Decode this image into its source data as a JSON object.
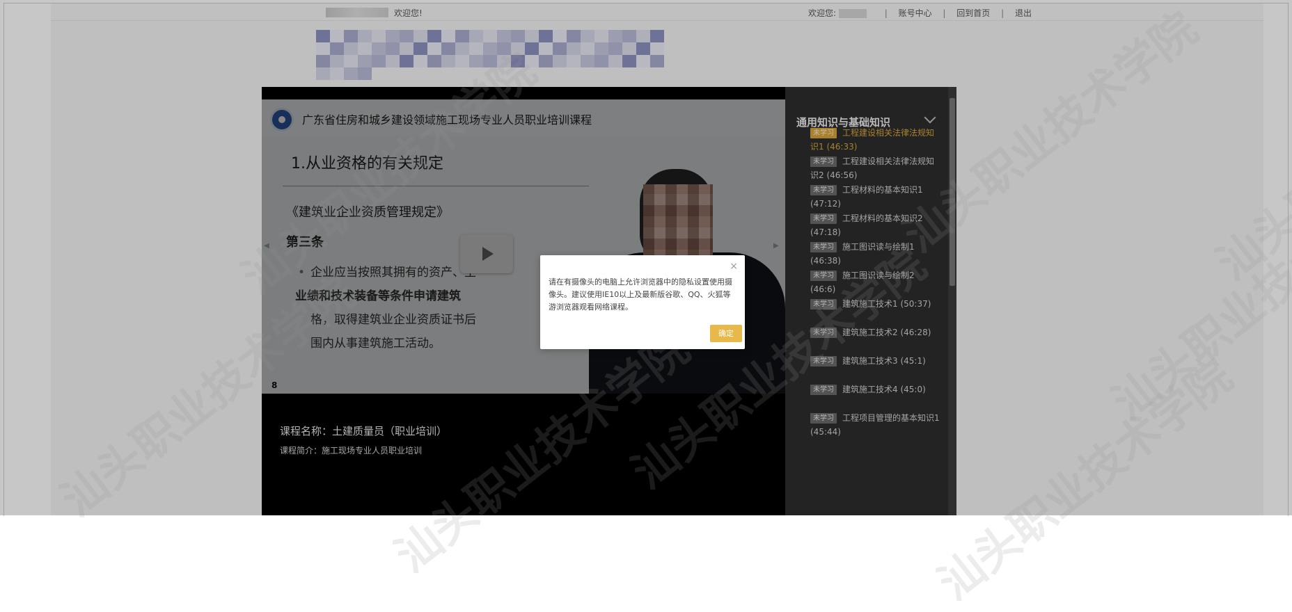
{
  "topbar": {
    "welcome_left": "欢迎您!",
    "welcome_right": "欢迎您:",
    "links": [
      "账号中心",
      "回到首页",
      "退出"
    ],
    "separator": "|"
  },
  "player": {
    "slide": {
      "org": "广东省住房和城乡建设领域施工现场专业人员职业培训课程",
      "title": "1.从业资格的有关规定",
      "law": "《建筑业企业资质管理规定》",
      "article": "第三条",
      "body": "企业应当按照其拥有的资产、主要人员、已完成的工程业绩和技术装备等条件申请建筑业企业资质，经审查合格，取得建筑业企业资质证书后，方可在资质许可的范围内从事建筑施工活动。",
      "body_visible_line1": "企业应当按照其拥有的资产、主",
      "body_visible_line2": "业绩和技术装备等条件申请建筑",
      "body_visible_line3": "格，取得建筑业企业资质证书后",
      "body_visible_line4": "围内从事建筑施工活动。",
      "page_number": "8"
    },
    "course_title": "课程名称：土建质量员（职业培训）",
    "course_intro": "课程简介：施工现场专业人员职业培训"
  },
  "sidebar": {
    "section_title": "通用知识与基础知识",
    "lessons": [
      {
        "badge": "未学习",
        "title": "工程建设相关法律法规知识1 (46:33)",
        "active": true
      },
      {
        "badge": "未学习",
        "title": "工程建设相关法律法规知识2 (46:56)",
        "active": false
      },
      {
        "badge": "未学习",
        "title": "工程材料的基本知识1 (47:12)",
        "active": false
      },
      {
        "badge": "未学习",
        "title": "工程材料的基本知识2 (47:18)",
        "active": false
      },
      {
        "badge": "未学习",
        "title": "施工图识读与绘制1 (46:38)",
        "active": false
      },
      {
        "badge": "未学习",
        "title": "施工图识读与绘制2 (46:6)",
        "active": false
      },
      {
        "badge": "未学习",
        "title": "建筑施工技术1 (50:37)",
        "active": false
      },
      {
        "badge": "未学习",
        "title": "建筑施工技术2 (46:28)",
        "active": false
      },
      {
        "badge": "未学习",
        "title": "建筑施工技术3 (45:1)",
        "active": false
      },
      {
        "badge": "未学习",
        "title": "建筑施工技术4 (45:0)",
        "active": false
      },
      {
        "badge": "未学习",
        "title": "工程项目管理的基本知识1 (45:44)",
        "active": false
      }
    ]
  },
  "dialog": {
    "message": "请在有摄像头的电脑上允许浏览器中的隐私设置使用摄像头。建议使用IE10以上及最新版谷歌、QQ、火狐等游浏览器观看网络课程。",
    "close_glyph": "×",
    "ok_label": "确定"
  },
  "watermark": {
    "text": "汕头职业技术学院"
  },
  "colors": {
    "accent": "#e8b84a",
    "sidebar_bg": "#2e2e2e",
    "active_lesson": "#d9a63a"
  }
}
